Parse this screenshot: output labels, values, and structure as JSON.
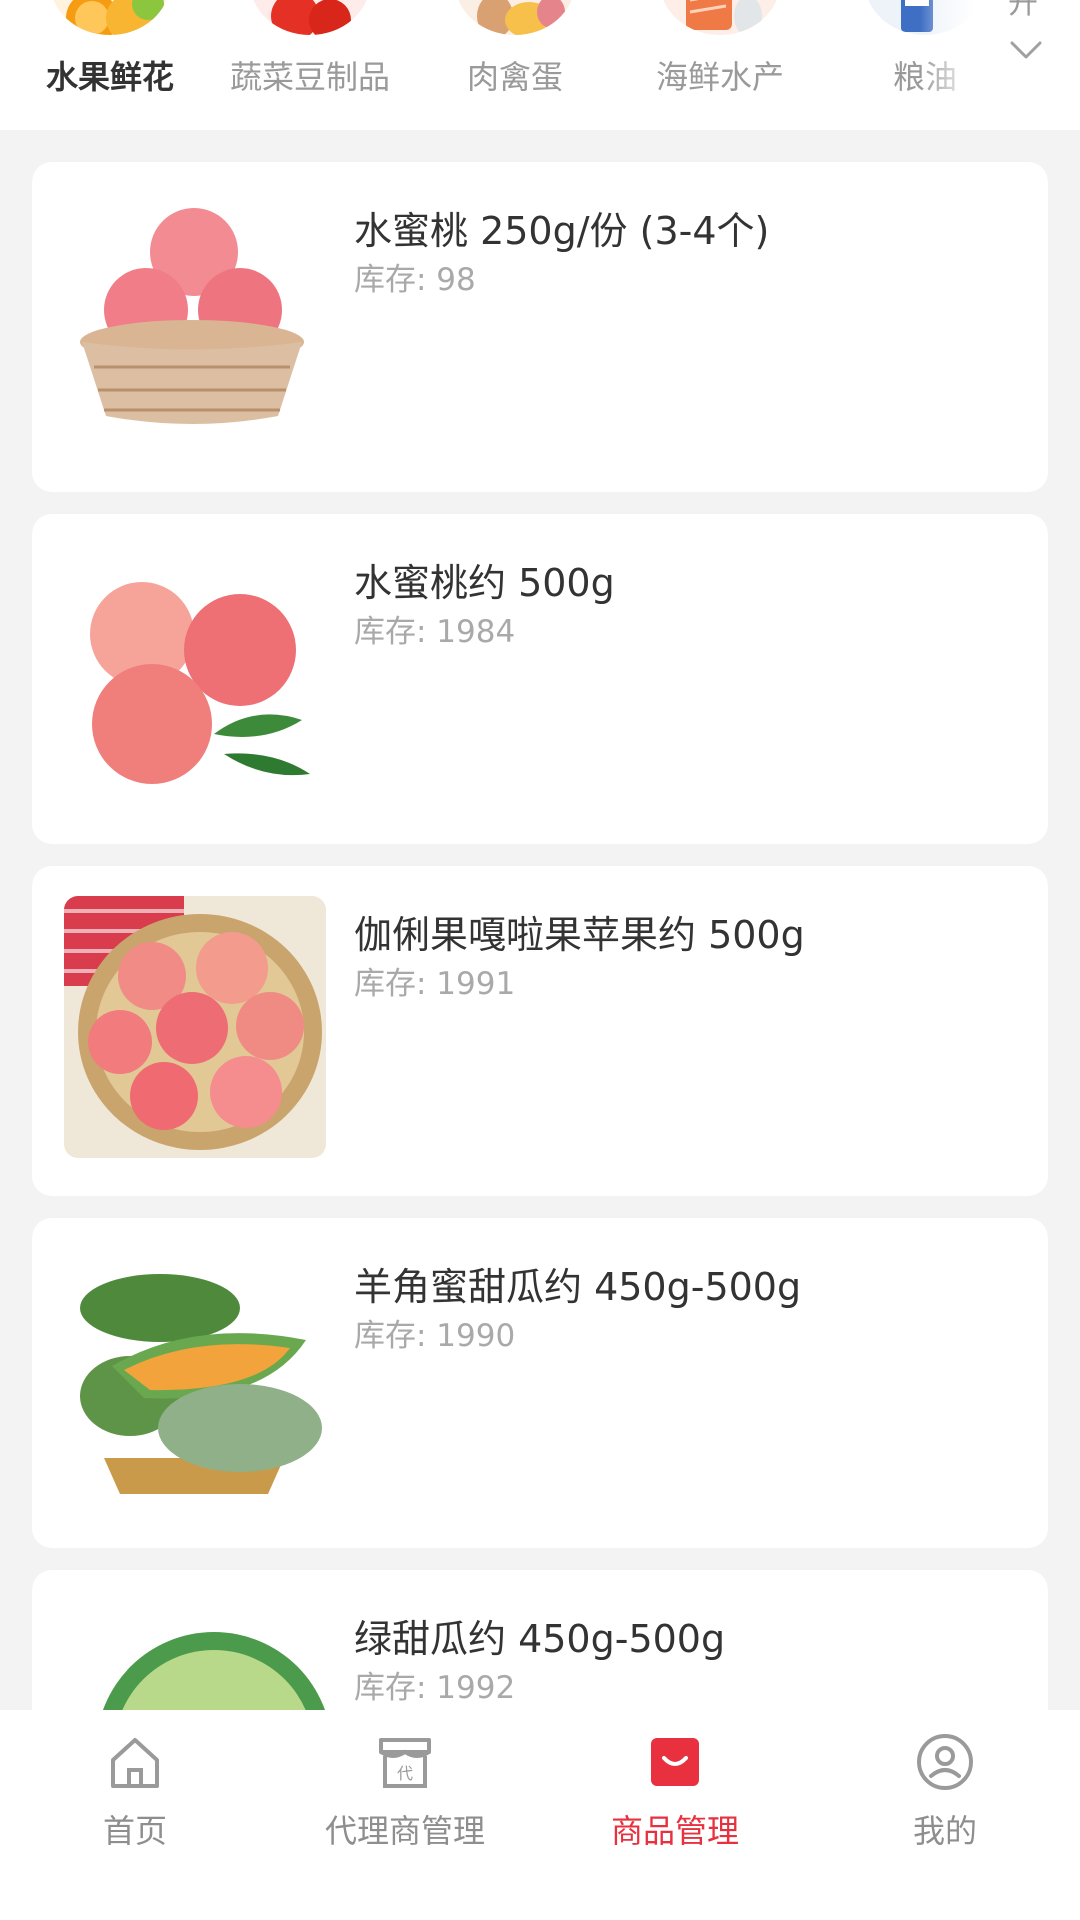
{
  "categories": [
    {
      "label": "水果鲜花",
      "icon": "fruit-thumbnail",
      "active": true
    },
    {
      "label": "蔬菜豆制品",
      "icon": "vegetable-thumbnail",
      "active": false
    },
    {
      "label": "肉禽蛋",
      "icon": "meat-egg-thumbnail",
      "active": false
    },
    {
      "label": "海鲜水产",
      "icon": "seafood-thumbnail",
      "active": false
    },
    {
      "label": "粮油",
      "icon": "grain-oil-thumbnail",
      "active": false
    }
  ],
  "category_expand": {
    "text": "开",
    "icon": "chevron-down-icon"
  },
  "products": [
    {
      "title": "水蜜桃 250g/份 (3-4个)",
      "stock": "库存: 98",
      "image": "peach-basket-image"
    },
    {
      "title": "水蜜桃约 500g",
      "stock": "库存: 1984",
      "image": "peaches-leaves-image"
    },
    {
      "title": "伽俐果嘎啦果苹果约 500g",
      "stock": "库存: 1991",
      "image": "gala-apple-basket-image"
    },
    {
      "title": "羊角蜜甜瓜约 450g-500g",
      "stock": "库存: 1990",
      "image": "horn-melon-image"
    },
    {
      "title": "绿甜瓜约 450g-500g",
      "stock": "库存: 1992",
      "image": "green-melon-image"
    }
  ],
  "tabs": [
    {
      "label": "首页",
      "icon": "home-icon",
      "active": false
    },
    {
      "label": "代理商管理",
      "icon": "agent-store-icon",
      "active": false
    },
    {
      "label": "商品管理",
      "icon": "shopping-bag-icon",
      "active": true
    },
    {
      "label": "我的",
      "icon": "user-icon",
      "active": false
    }
  ],
  "colors": {
    "accent": "#e8303f",
    "inactive_text": "#8e8e8e",
    "background": "#f3f3f3"
  }
}
